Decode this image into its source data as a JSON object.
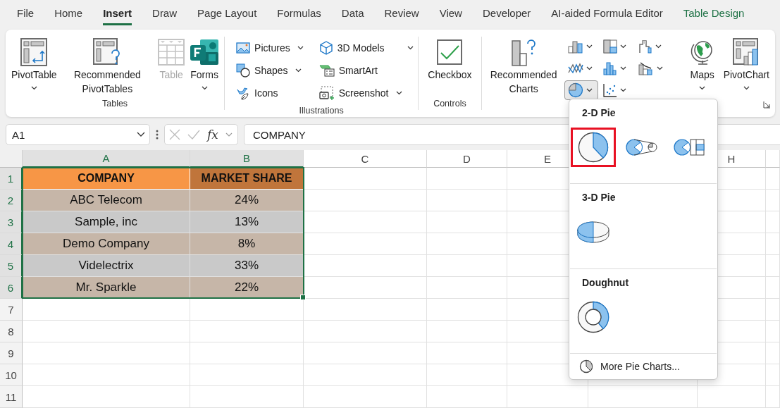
{
  "menu_tabs": [
    {
      "label": "File",
      "selected": false,
      "kind": "normal"
    },
    {
      "label": "Home",
      "selected": false,
      "kind": "normal"
    },
    {
      "label": "Insert",
      "selected": true,
      "kind": "normal"
    },
    {
      "label": "Draw",
      "selected": false,
      "kind": "normal"
    },
    {
      "label": "Page Layout",
      "selected": false,
      "kind": "normal"
    },
    {
      "label": "Formulas",
      "selected": false,
      "kind": "normal"
    },
    {
      "label": "Data",
      "selected": false,
      "kind": "normal"
    },
    {
      "label": "Review",
      "selected": false,
      "kind": "normal"
    },
    {
      "label": "View",
      "selected": false,
      "kind": "normal"
    },
    {
      "label": "Developer",
      "selected": false,
      "kind": "normal"
    },
    {
      "label": "AI-aided Formula Editor",
      "selected": false,
      "kind": "normal"
    },
    {
      "label": "Table Design",
      "selected": false,
      "kind": "contextual"
    }
  ],
  "ribbon": {
    "groups": [
      {
        "kind": "large",
        "label": "Tables",
        "buttons": [
          {
            "kind": "pivottable",
            "label": "PivotTable",
            "dropdown": true,
            "disabled": false
          },
          {
            "kind": "recpivot",
            "label": "Recommended PivotTables",
            "dropdown": false,
            "disabled": false
          },
          {
            "kind": "table",
            "label": "Table",
            "dropdown": false,
            "disabled": true
          },
          {
            "kind": "forms",
            "label": "Forms",
            "dropdown": true,
            "disabled": false
          }
        ]
      },
      {
        "kind": "small",
        "label": "Illustrations",
        "buttons": [
          {
            "kind": "pictures",
            "label": "Pictures",
            "dropdown": true,
            "disabled": false
          },
          {
            "kind": "shapes",
            "label": "Shapes",
            "dropdown": true,
            "disabled": false
          },
          {
            "kind": "icons",
            "label": "Icons",
            "dropdown": false,
            "disabled": false
          },
          {
            "kind": "models",
            "label": "3D Models",
            "dropdown": true,
            "disabled": false
          },
          {
            "kind": "smartart",
            "label": "SmartArt",
            "dropdown": false,
            "disabled": false
          },
          {
            "kind": "screenshot",
            "label": "Screenshot",
            "dropdown": true,
            "disabled": false
          }
        ]
      },
      {
        "kind": "large",
        "label": "Controls",
        "buttons": [
          {
            "kind": "checkbox",
            "label": "Checkbox",
            "dropdown": false,
            "disabled": false
          }
        ]
      },
      {
        "kind": "charts",
        "buttons": [
          {
            "kind": "reccharts",
            "label": "Recommended Charts",
            "dropdown": false,
            "disabled": false
          },
          {
            "kind": "maps",
            "label": "Maps",
            "dropdown": true,
            "disabled": false
          },
          {
            "kind": "pivotchart",
            "label": "PivotChart",
            "dropdown": true,
            "disabled": false
          }
        ],
        "chart_types": [
          {
            "kind": "column",
            "selected": false
          },
          {
            "kind": "hierarchy",
            "selected": false
          },
          {
            "kind": "waterfall",
            "selected": false
          },
          {
            "kind": "line",
            "selected": false
          },
          {
            "kind": "statistic",
            "selected": false
          },
          {
            "kind": "combo",
            "selected": false
          },
          {
            "kind": "pie",
            "selected": true
          },
          {
            "kind": "scatter",
            "selected": false
          }
        ]
      }
    ]
  },
  "formula_bar": {
    "name_box": "A1",
    "value": "COMPANY",
    "fx": "fx"
  },
  "sheet": {
    "columns": [
      {
        "label": "A",
        "selected": true
      },
      {
        "label": "B",
        "selected": true
      },
      {
        "label": "C",
        "selected": false
      },
      {
        "label": "D",
        "selected": false
      },
      {
        "label": "E",
        "selected": false
      },
      {
        "label": "H",
        "selected": false
      }
    ],
    "rows": [
      {
        "number": "1",
        "selected": true,
        "kind": "header",
        "cells": [
          "COMPANY",
          "MARKET SHARE"
        ]
      },
      {
        "number": "2",
        "selected": true,
        "kind": "data",
        "cells": [
          "ABC Telecom",
          "24%"
        ]
      },
      {
        "number": "3",
        "selected": true,
        "kind": "data",
        "cells": [
          "Sample, inc",
          "13%"
        ]
      },
      {
        "number": "4",
        "selected": true,
        "kind": "data",
        "cells": [
          "Demo Company",
          "8%"
        ]
      },
      {
        "number": "5",
        "selected": true,
        "kind": "data",
        "cells": [
          "Videlectrix",
          "33%"
        ]
      },
      {
        "number": "6",
        "selected": true,
        "kind": "data",
        "cells": [
          "Mr. Sparkle",
          "22%"
        ]
      },
      {
        "number": "7",
        "selected": false,
        "kind": "data"
      },
      {
        "number": "8",
        "selected": false,
        "kind": "data"
      },
      {
        "number": "9",
        "selected": false,
        "kind": "data"
      },
      {
        "number": "10",
        "selected": false,
        "kind": "data"
      },
      {
        "number": "11",
        "selected": false,
        "kind": "data"
      }
    ]
  },
  "pie_menu": {
    "sections": [
      {
        "title": "2-D Pie",
        "items": [
          {
            "kind": "pie",
            "selected": true
          },
          {
            "kind": "pie-of-pie",
            "selected": false
          },
          {
            "kind": "bar-of-pie",
            "selected": false
          }
        ]
      },
      {
        "title": "3-D Pie",
        "items": [
          {
            "kind": "pie-3d",
            "selected": false
          }
        ]
      },
      {
        "title": "Doughnut",
        "items": [
          {
            "kind": "doughnut",
            "selected": false
          }
        ]
      }
    ],
    "footer": "More Pie Charts..."
  }
}
